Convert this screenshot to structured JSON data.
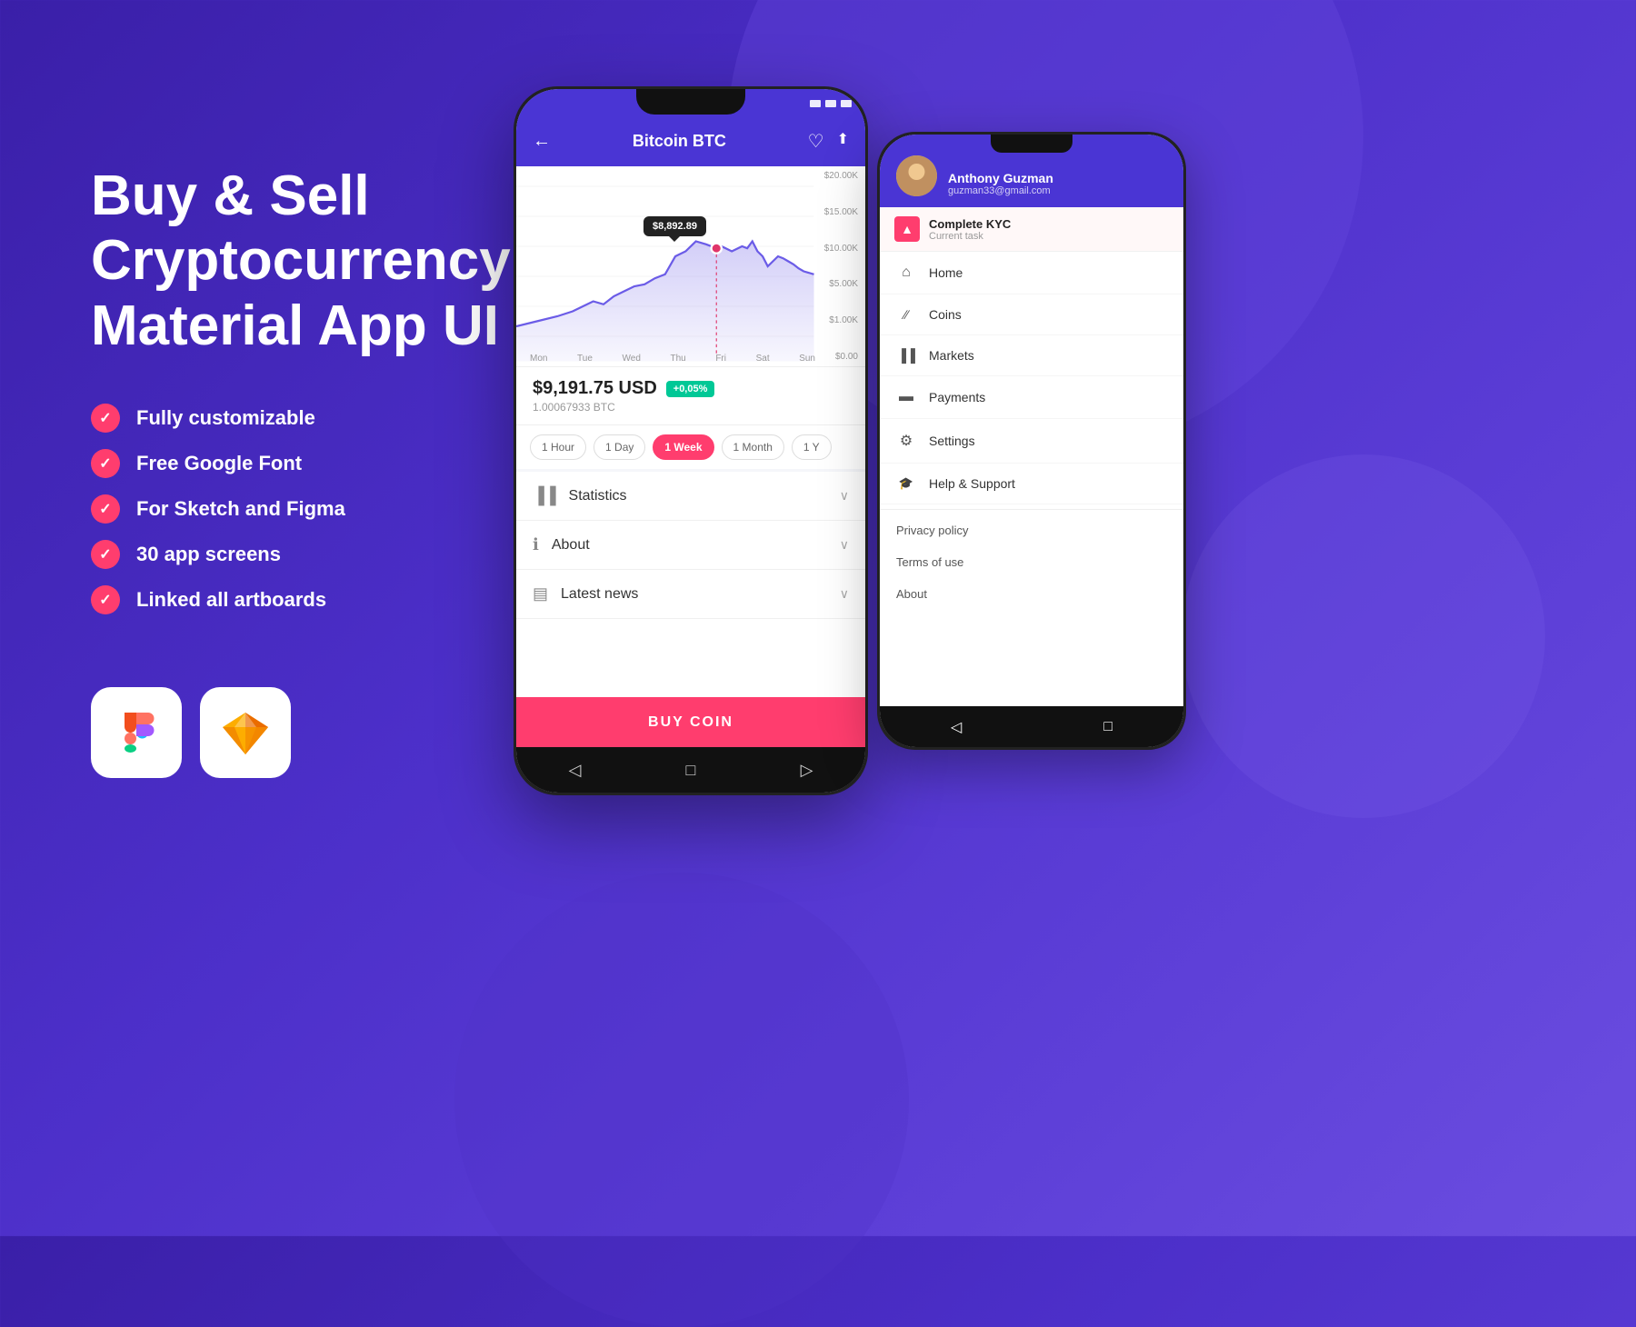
{
  "background": {
    "color": "#4a2fd4"
  },
  "left": {
    "title": "Buy & Sell\nCryptocurrency\nMaterial App UI Kit",
    "features": [
      "Fully customizable",
      "Free Google Font",
      "For Sketch and Figma",
      "30 app screens",
      "Linked all artboards"
    ],
    "apps": [
      {
        "name": "figma",
        "icon": "Figma"
      },
      {
        "name": "sketch",
        "icon": "Sketch"
      }
    ]
  },
  "phone1": {
    "status_icons": [
      "■",
      "■",
      "▲"
    ],
    "header": {
      "back_label": "←",
      "title": "Bitcoin BTC",
      "heart_icon": "♡",
      "share_icon": "⤶"
    },
    "chart": {
      "tooltip": "$8,892.89",
      "y_labels": [
        "$20.00K",
        "$15.00K",
        "$10.00K",
        "$5.00K",
        "$1.00K",
        "$0.00"
      ],
      "x_labels": [
        "Mon",
        "Tue",
        "Wed",
        "Thu",
        "Fri",
        "Sat",
        "Sun"
      ]
    },
    "price": {
      "amount": "$9,191.75 USD",
      "badge": "+0,05%",
      "sub": "1.00067933 BTC"
    },
    "time_filters": [
      "1 Hour",
      "1 Day",
      "1 Week",
      "1 Month",
      "1 Y"
    ],
    "sections": [
      {
        "icon": "📊",
        "label": "Statistics"
      },
      {
        "icon": "ℹ",
        "label": "About"
      },
      {
        "icon": "📰",
        "label": "Latest news"
      }
    ],
    "buy_button": "BUY COIN",
    "nav_icons": [
      "◄",
      "■",
      "▲"
    ]
  },
  "phone2": {
    "user": {
      "name": "Anthony Guzman",
      "email": "guzman33@gmail.com"
    },
    "kyc": {
      "title": "Complete KYC",
      "subtitle": "Current task"
    },
    "nav_items": [
      {
        "icon": "⌂",
        "label": "Home"
      },
      {
        "icon": "∕",
        "label": "Coins"
      },
      {
        "icon": "▐▐",
        "label": "Markets"
      },
      {
        "icon": "▬",
        "label": "Payments"
      },
      {
        "icon": "⚙",
        "label": "Settings"
      },
      {
        "icon": "🎓",
        "label": "Help & Support"
      }
    ],
    "nav_links": [
      "Privacy policy",
      "Terms of use",
      "About"
    ],
    "nav_icons": [
      "◄",
      "■",
      "▲"
    ]
  }
}
